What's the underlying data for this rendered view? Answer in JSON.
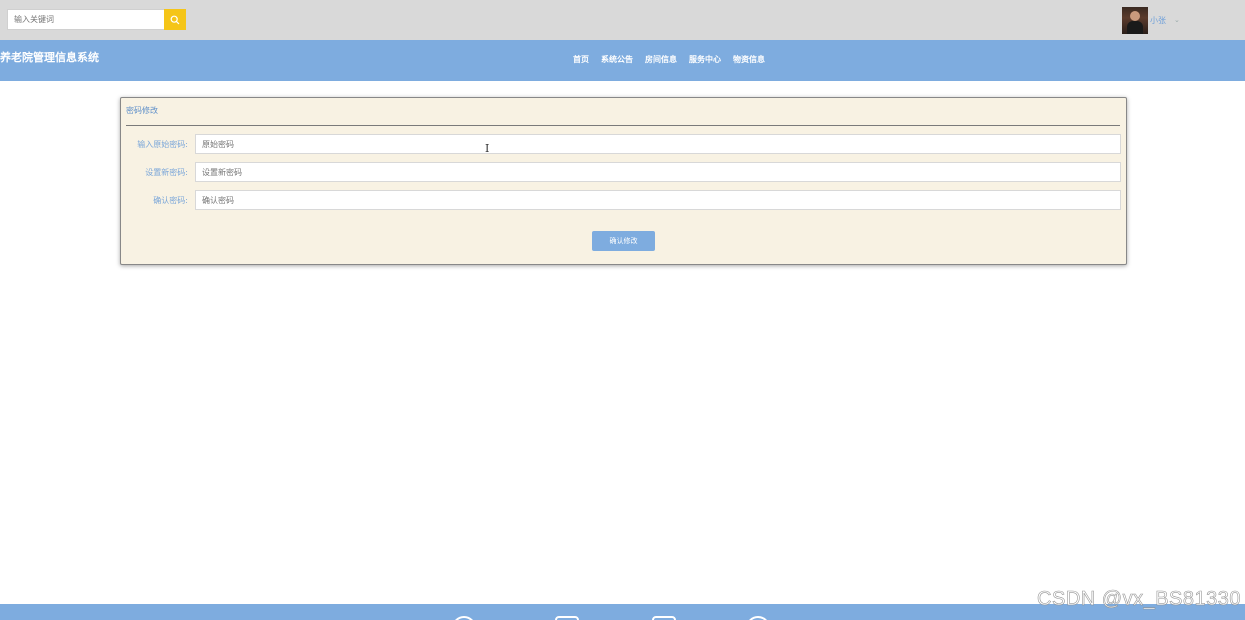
{
  "search": {
    "placeholder": "输入关键词",
    "value": ""
  },
  "user": {
    "name": "小张"
  },
  "site": {
    "title": "养老院管理信息系统"
  },
  "nav": [
    {
      "label": "首页"
    },
    {
      "label": "系统公告"
    },
    {
      "label": "房间信息"
    },
    {
      "label": "服务中心"
    },
    {
      "label": "物资信息"
    }
  ],
  "form": {
    "title": "密码修改",
    "fields": [
      {
        "label": "输入原始密码:",
        "placeholder": "原始密码"
      },
      {
        "label": "设置新密码:",
        "placeholder": "设置新密码"
      },
      {
        "label": "确认密码:",
        "placeholder": "确认密码"
      }
    ],
    "submit_label": "确认修改"
  },
  "watermark": "CSDN @vx_BS81330",
  "colors": {
    "accent": "#7eacdf",
    "search_button": "#f5c518",
    "panel_bg": "#f8f2e3"
  }
}
